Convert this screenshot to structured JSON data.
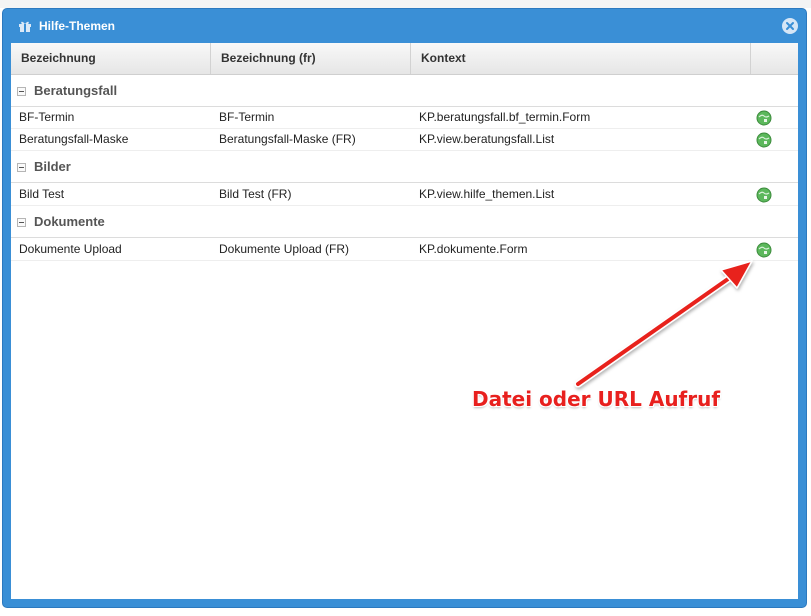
{
  "window": {
    "title": "Hilfe-Themen",
    "close_icon": "close-icon",
    "title_icon": "gift-icon"
  },
  "columns": [
    "Bezeichnung",
    "Bezeichnung (fr)",
    "Kontext",
    ""
  ],
  "groups": [
    {
      "label": "Beratungsfall",
      "rows": [
        {
          "name": "BF-Termin",
          "name_fr": "BF-Termin",
          "context": "KP.beratungsfall.bf_termin.Form"
        },
        {
          "name": "Beratungsfall-Maske",
          "name_fr": "Beratungsfall-Maske (FR)",
          "context": "KP.view.beratungsfall.List"
        }
      ]
    },
    {
      "label": "Bilder",
      "rows": [
        {
          "name": "Bild Test",
          "name_fr": "Bild Test (FR)",
          "context": "KP.view.hilfe_themen.List"
        }
      ]
    },
    {
      "label": "Dokumente",
      "rows": [
        {
          "name": "Dokumente Upload",
          "name_fr": "Dokumente Upload (FR)",
          "context": "KP.dokumente.Form"
        }
      ]
    }
  ],
  "row_action_icon": "globe-link-icon",
  "annotation": {
    "text": "Datei oder URL Aufruf",
    "color": "#e8201e"
  },
  "colors": {
    "window_blue": "#3a8fd6",
    "action_green": "#5cb85c"
  }
}
